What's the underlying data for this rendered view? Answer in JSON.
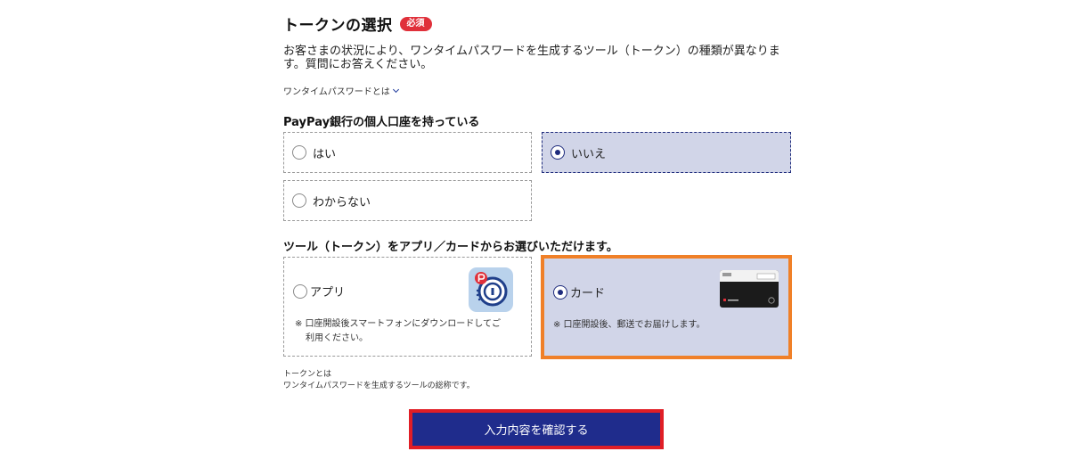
{
  "section": {
    "title": "トークンの選択",
    "required_badge": "必須",
    "description_line1": "お客さまの状況により、ワンタイムパスワードを生成するツール（トークン）の種類が異なりま",
    "description_line2": "す。質問にお答えください。",
    "otp_link": "ワンタイムパスワードとは"
  },
  "question1": {
    "label": "PayPay銀行の個人口座を持っている",
    "options": [
      {
        "label": "はい",
        "selected": false
      },
      {
        "label": "いいえ",
        "selected": true
      },
      {
        "label": "わからない",
        "selected": false
      }
    ]
  },
  "question2": {
    "label": "ツール（トークン）をアプリ／カードからお選びいただけます。",
    "options": [
      {
        "label": "アプリ",
        "note_line1": "※ 口座開設後スマートフォンにダウンロードしてご",
        "note_line2": "利用ください。",
        "image": "paypay-token-app-icon",
        "selected": false
      },
      {
        "label": "カード",
        "note_line1": "※ 口座開設後、郵送でお届けします。",
        "image": "token-card-image",
        "selected": true
      }
    ]
  },
  "footnote": {
    "line1": "トークンとは",
    "line2": "ワンタイムパスワードを生成するツールの総称です。"
  },
  "submit": {
    "label": "入力内容を確認する"
  },
  "colors": {
    "accent_navy": "#1f2c8c",
    "selected_bg": "#d1d5e8",
    "required_red": "#e0303a",
    "highlight_orange": "#f08028",
    "highlight_red": "#e01e26"
  }
}
